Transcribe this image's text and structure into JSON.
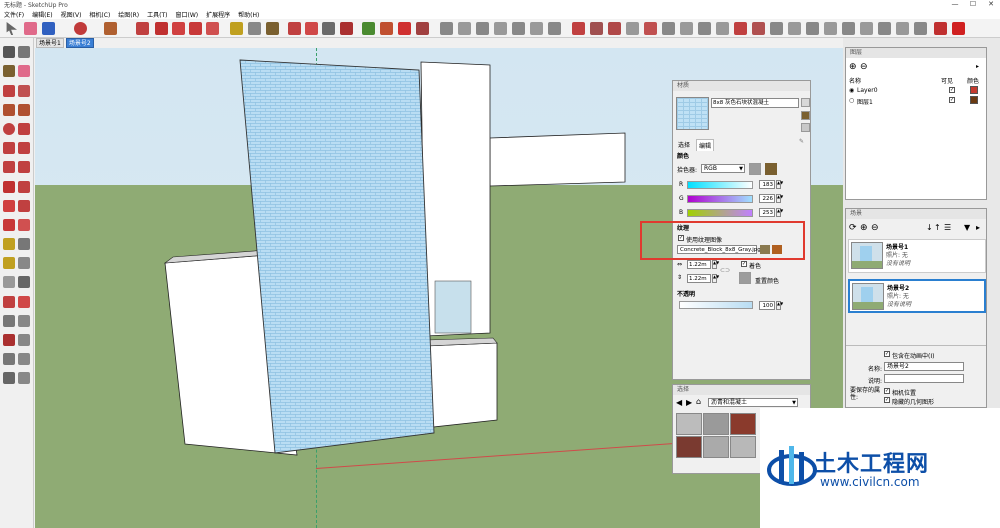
{
  "window": {
    "title": "无标题 - SketchUp Pro",
    "controls": [
      "—",
      "☐",
      "✕"
    ]
  },
  "menu": [
    "文件(F)",
    "编辑(E)",
    "视图(V)",
    "相机(C)",
    "绘图(R)",
    "工具(T)",
    "窗口(W)",
    "扩展程序",
    "帮助(H)"
  ],
  "scene_tabs": [
    "场景号1",
    "场景号2"
  ],
  "materials": {
    "title": "材质",
    "name": "8x8 灰色石块状混凝土",
    "tab_select": "选择",
    "tab_edit": "编辑",
    "color_header": "颜色",
    "picker_label": "拾色器:",
    "picker_value": "RGB",
    "r_label": "R",
    "r_value": "183",
    "g_label": "G",
    "g_value": "226",
    "b_label": "B",
    "b_value": "253",
    "texture_header": "纹理",
    "use_texture": "使用纹理图像",
    "texture_file": "Concrete_Block_8x8_Gray.jpg",
    "width": "1.22m",
    "height": "1.22m",
    "colorize": "着色",
    "reset_color": "重置颜色",
    "opacity_header": "不透明",
    "opacity_value": "100"
  },
  "select_panel": {
    "title": "选择",
    "category": "沥青和混凝土"
  },
  "layers": {
    "title": "图层",
    "col_name": "名称",
    "col_visible": "可见",
    "col_color": "颜色",
    "rows": [
      {
        "name": "Layer0",
        "color": "#c43b2f"
      },
      {
        "name": "图层1",
        "color": "#6a3a12"
      }
    ]
  },
  "scenes": {
    "title": "场景",
    "items": [
      {
        "name": "场景号1",
        "photo": "照片: 无",
        "desc": "没有说明"
      },
      {
        "name": "场景号2",
        "photo": "照片: 无",
        "desc": "没有说明"
      }
    ],
    "include_anim": "包含在动画中(I)",
    "name_label": "名称:",
    "name_value": "场景号2",
    "desc_label": "说明:",
    "save_props_label": "要保存的属性:",
    "camera_pos": "相机位置",
    "hidden_geo": "隐藏的几何图形"
  },
  "watermark": {
    "cn": "土木工程网",
    "url": "www.civilcn.com"
  }
}
